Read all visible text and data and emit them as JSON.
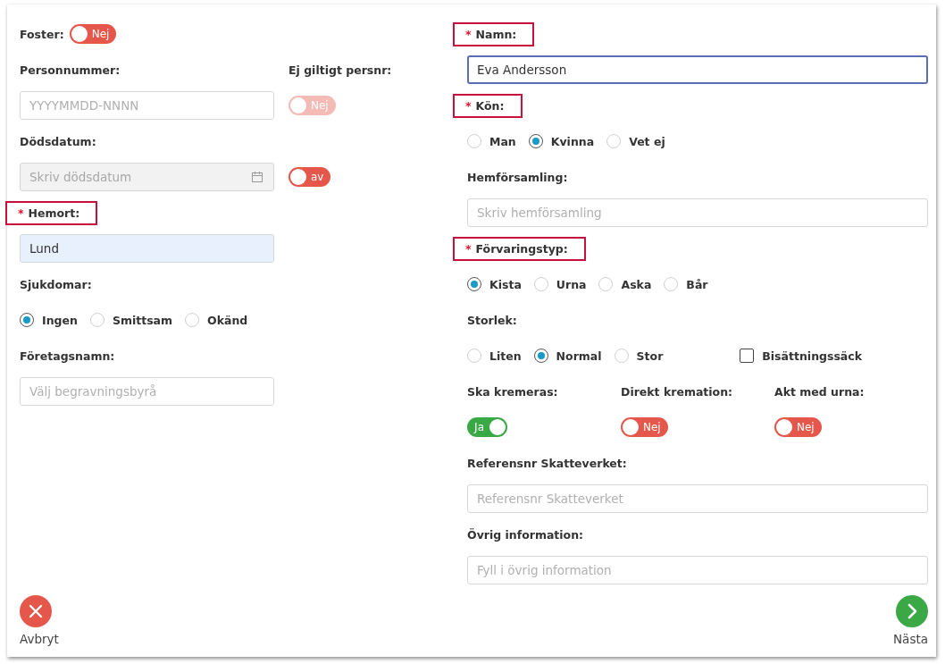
{
  "form": {
    "columns": [
      {
        "rows": [
          [
            {
              "kind": "label",
              "text": "Foster:",
              "toggle": {
                "label": "Nej",
                "on": false,
                "disabled": false
              }
            }
          ],
          [
            {
              "kind": "label",
              "text": "Personnummer:"
            },
            {
              "kind": "label",
              "text": "Ej giltigt persnr:"
            }
          ],
          [
            {
              "kind": "input",
              "placeholder": "YYYYMMDD-NNNN"
            },
            {
              "kind": "toggle",
              "label": "Nej",
              "on": false,
              "disabled": true
            }
          ],
          [
            {
              "kind": "label",
              "text": "Dödsdatum:"
            }
          ],
          [
            {
              "kind": "date",
              "placeholder": "Skriv dödsdatum",
              "disabled": true
            },
            {
              "kind": "toggle",
              "label": "av",
              "on": false,
              "disabled": false
            }
          ],
          [
            {
              "kind": "label",
              "text": "Hemort:",
              "asterisk": "*",
              "highlighted": true
            }
          ],
          [
            {
              "kind": "input",
              "value": "Lund",
              "autofilled": true
            }
          ],
          [
            {
              "kind": "label",
              "text": "Sjukdomar:"
            }
          ],
          [
            {
              "kind": "radios",
              "options": [
                {
                  "label": "Ingen",
                  "selected": true
                },
                {
                  "label": "Smittsam",
                  "selected": false
                },
                {
                  "label": "Okänd",
                  "selected": false
                }
              ]
            }
          ],
          [
            {
              "kind": "label",
              "text": "Företagsnamn:"
            }
          ],
          [
            {
              "kind": "input",
              "placeholder": "Välj begravningsbyrå"
            }
          ]
        ]
      },
      {
        "rows": [
          [
            {
              "kind": "label",
              "text": "Namn:",
              "asterisk": "*",
              "highlighted": true
            }
          ],
          [
            {
              "kind": "input",
              "value": "Eva Andersson",
              "focused": true
            }
          ],
          [
            {
              "kind": "label",
              "text": "Kön:",
              "asterisk": "*",
              "highlighted": true
            }
          ],
          [
            {
              "kind": "radios",
              "options": [
                {
                  "label": "Man",
                  "selected": false
                },
                {
                  "label": "Kvinna",
                  "selected": true
                },
                {
                  "label": "Vet ej",
                  "selected": false
                }
              ]
            }
          ],
          [
            {
              "kind": "label",
              "text": "Hemförsamling:"
            }
          ],
          [
            {
              "kind": "input",
              "placeholder": "Skriv hemförsamling"
            }
          ],
          [
            {
              "kind": "label",
              "text": "Förvaringstyp:",
              "asterisk": "*",
              "highlighted": true
            }
          ],
          [
            {
              "kind": "radios",
              "options": [
                {
                  "label": "Kista",
                  "selected": true
                },
                {
                  "label": "Urna",
                  "selected": false
                },
                {
                  "label": "Aska",
                  "selected": false
                },
                {
                  "label": "Bår",
                  "selected": false
                }
              ]
            }
          ],
          [
            {
              "kind": "label",
              "text": "Storlek:"
            }
          ],
          [
            {
              "kind": "radios",
              "options": [
                {
                  "label": "Liten",
                  "selected": false
                },
                {
                  "label": "Normal",
                  "selected": true
                },
                {
                  "label": "Stor",
                  "selected": false
                }
              ]
            },
            {
              "kind": "checkbox",
              "label": "Bisättningssäck",
              "checked": false
            }
          ],
          [
            {
              "kind": "toggle_group",
              "items": [
                {
                  "text": "Ska kremeras:",
                  "toggle": {
                    "label": "Ja",
                    "on": true,
                    "disabled": false
                  }
                },
                {
                  "text": "Direkt kremation:",
                  "toggle": {
                    "label": "Nej",
                    "on": false,
                    "disabled": false
                  }
                },
                {
                  "text": "Akt med urna:",
                  "toggle": {
                    "label": "Nej",
                    "on": false,
                    "disabled": false
                  }
                }
              ]
            }
          ],
          [
            {
              "kind": "label",
              "text": "Referensnr Skatteverket:"
            }
          ],
          [
            {
              "kind": "input",
              "placeholder": "Referensnr Skatteverket"
            }
          ],
          [
            {
              "kind": "label",
              "text": "Övrig information:"
            }
          ],
          [
            {
              "kind": "input",
              "placeholder": "Fyll i övrig information"
            }
          ]
        ]
      }
    ]
  },
  "actions": [
    {
      "kind": "cancel",
      "label": "Avbryt"
    },
    {
      "kind": "next",
      "label": "Nästa"
    }
  ]
}
